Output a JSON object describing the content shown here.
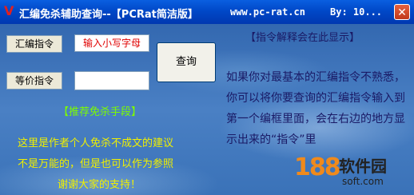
{
  "window": {
    "title": "汇编免杀辅助查询--【PCRat简洁版】",
    "url_text": "www.pc-rat.cn",
    "by_text": "By: 10...",
    "close_glyph": "✕",
    "icon_glyph": "V"
  },
  "form": {
    "asm_label": "汇编指令",
    "asm_value": "输入小写字母",
    "equiv_label": "等价指令",
    "equiv_value": "",
    "query_button": "查询"
  },
  "hint": {
    "title": "【指令解释会在此显示】",
    "body": "如果你对最基本的汇编指令不熟悉，你可以将你要查询的汇编指令输入到第一个编框里面，会在右边的地方显示出来的“指令”里"
  },
  "recommend": {
    "title": "【推荐免杀手段】",
    "lines": [
      "这里是作者个人免杀不成文的建议",
      "不是万能的，但是也可以作为参照",
      "谢谢大家的支持！"
    ]
  },
  "watermark": {
    "logo_number": "188",
    "name": "软件园",
    "url": "soft.com"
  },
  "colors": {
    "titlebar": "#0048c8",
    "background": "#3a6fb3",
    "recommend_text": "#7cfc00",
    "advice_text": "#f0f000",
    "hint_text": "#1a1a66",
    "input_text": "#e00000"
  }
}
